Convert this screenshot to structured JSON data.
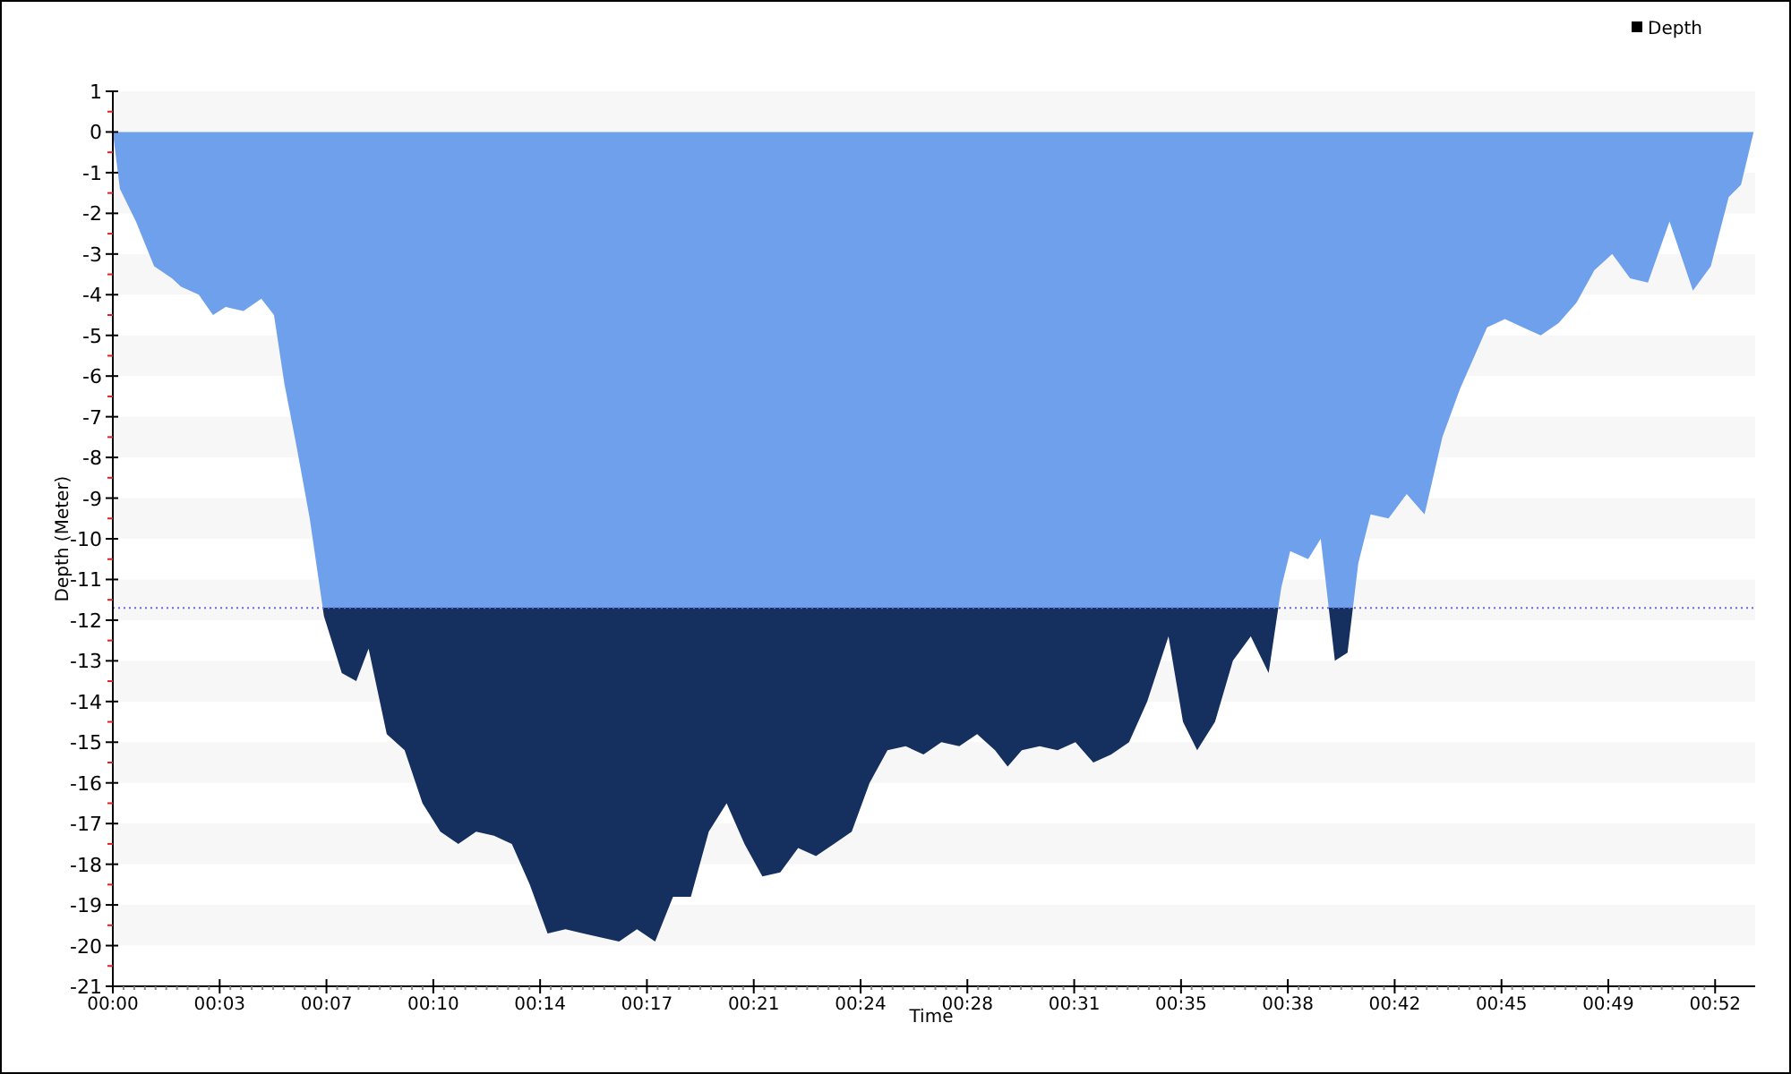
{
  "chart_data": {
    "type": "area",
    "xlabel": "Time",
    "ylabel": "Depth (Meter)",
    "xlim": [
      0,
      53.3
    ],
    "ylim": [
      -21,
      1
    ],
    "x": [
      0,
      0.23,
      0.75,
      1.34,
      1.92,
      2.21,
      2.79,
      3.25,
      3.66,
      4.24,
      4.82,
      5.23,
      5.57,
      5.98,
      6.39,
      6.85,
      7.43,
      7.9,
      8.3,
      8.89,
      9.47,
      10.05,
      10.63,
      11.21,
      11.79,
      12.37,
      12.95,
      13.53,
      14.11,
      14.69,
      15.27,
      15.85,
      16.43,
      17.01,
      17.6,
      18.18,
      18.76,
      19.34,
      19.92,
      20.5,
      21.08,
      21.66,
      22.24,
      22.82,
      23.4,
      23.98,
      24.56,
      25.14,
      25.73,
      26.31,
      26.89,
      27.47,
      28.05,
      28.63,
      29.04,
      29.5,
      30.08,
      30.66,
      31.24,
      31.82,
      32.4,
      32.98,
      33.57,
      34.26,
      34.73,
      35.19,
      35.77,
      36.35,
      36.93,
      37.51,
      37.92,
      38.21,
      38.79,
      39.2,
      39.66,
      40.07,
      40.42,
      40.82,
      41.4,
      41.99,
      42.57,
      43.15,
      43.73,
      44.6,
      45.18,
      45.76,
      46.34,
      46.92,
      47.5,
      48.08,
      48.66,
      49.24,
      49.82,
      50.52,
      51.28,
      51.86,
      52.44,
      52.84,
      53.25
    ],
    "series": [
      {
        "name": "Depth",
        "color": "#6fa0ec",
        "values": [
          0,
          -1.4,
          -2.2,
          -3.3,
          -3.6,
          -3.8,
          -4.0,
          -4.5,
          -4.3,
          -4.4,
          -4.1,
          -4.5,
          -6.2,
          -7.8,
          -9.5,
          -11.9,
          -13.3,
          -13.5,
          -12.7,
          -14.8,
          -15.2,
          -16.5,
          -17.2,
          -17.5,
          -17.2,
          -17.3,
          -17.5,
          -18.5,
          -19.7,
          -19.6,
          -19.7,
          -19.8,
          -19.9,
          -19.6,
          -19.9,
          -18.8,
          -18.8,
          -17.2,
          -16.5,
          -17.5,
          -18.3,
          -18.2,
          -17.6,
          -17.8,
          -17.5,
          -17.2,
          -16.0,
          -15.2,
          -15.1,
          -15.3,
          -15.0,
          -15.1,
          -14.8,
          -15.2,
          -15.6,
          -15.2,
          -15.1,
          -15.2,
          -15.0,
          -15.5,
          -15.3,
          -15.0,
          -14.0,
          -12.4,
          -14.5,
          -15.2,
          -14.5,
          -13.0,
          -12.4,
          -13.3,
          -11.2,
          -10.3,
          -10.5,
          -10.0,
          -13.0,
          -12.8,
          -10.6,
          -9.4,
          -9.5,
          -8.9,
          -9.4,
          -7.5,
          -6.3,
          -4.8,
          -4.6,
          -4.8,
          -5.0,
          -4.7,
          -4.2,
          -3.4,
          -3.0,
          -3.6,
          -3.7,
          -2.2,
          -3.9,
          -3.3,
          -1.6,
          -1.3,
          0
        ]
      }
    ],
    "xticks": [
      {
        "value": 0,
        "label": "00:00"
      },
      {
        "value": 3.467,
        "label": "00:03"
      },
      {
        "value": 6.933,
        "label": "00:07"
      },
      {
        "value": 10.4,
        "label": "00:10"
      },
      {
        "value": 13.867,
        "label": "00:14"
      },
      {
        "value": 17.333,
        "label": "00:17"
      },
      {
        "value": 20.8,
        "label": "00:21"
      },
      {
        "value": 24.267,
        "label": "00:24"
      },
      {
        "value": 27.733,
        "label": "00:28"
      },
      {
        "value": 31.2,
        "label": "00:31"
      },
      {
        "value": 34.667,
        "label": "00:35"
      },
      {
        "value": 38.133,
        "label": "00:38"
      },
      {
        "value": 41.6,
        "label": "00:42"
      },
      {
        "value": 45.067,
        "label": "00:45"
      },
      {
        "value": 48.533,
        "label": "00:49"
      },
      {
        "value": 52,
        "label": "00:52"
      }
    ],
    "yticks": [
      1,
      0,
      -1,
      -2,
      -3,
      -4,
      -5,
      -6,
      -7,
      -8,
      -9,
      -10,
      -11,
      -12,
      -13,
      -14,
      -15,
      -16,
      -17,
      -18,
      -19,
      -20,
      -21
    ],
    "ref_lines": [
      {
        "axis": "y",
        "value": -11.7
      }
    ]
  }
}
